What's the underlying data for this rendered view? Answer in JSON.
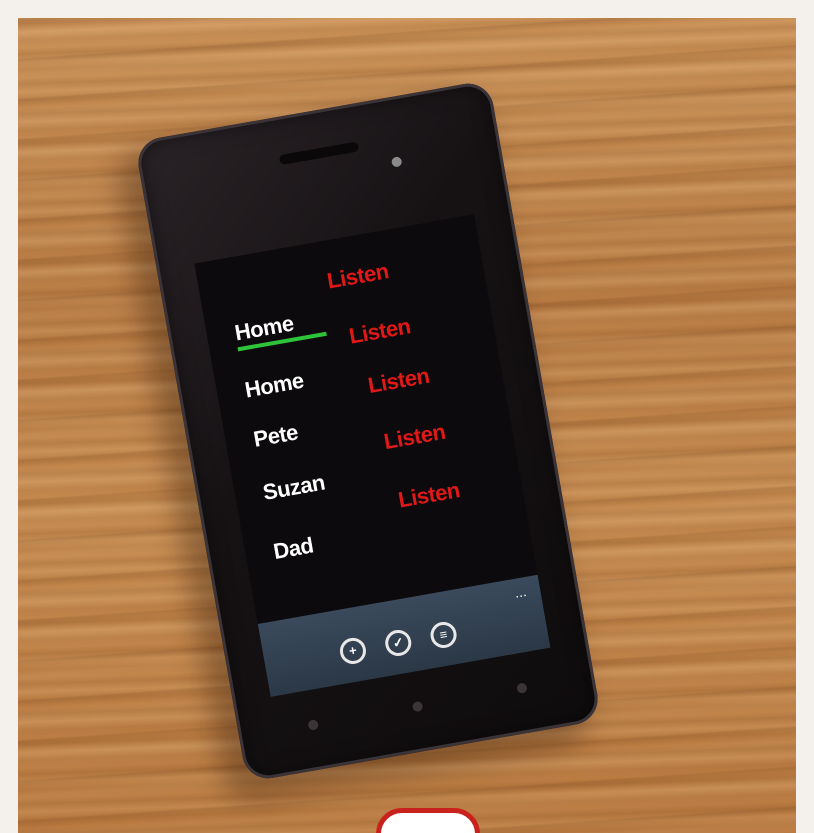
{
  "contacts": [
    {
      "name": "Home",
      "detail": "",
      "detail_color": "green"
    },
    {
      "name": "Home",
      "detail": "",
      "detail_color": "grey"
    },
    {
      "name": "Pete",
      "detail": "",
      "detail_color": "grey"
    },
    {
      "name": "Suzan",
      "detail": "",
      "detail_color": "grey"
    },
    {
      "name": "Dad",
      "detail": "",
      "detail_color": "grey"
    }
  ],
  "listen_label": "Listen",
  "app_bar": {
    "more": "...",
    "buttons": [
      {
        "icon": "add-icon",
        "glyph": "+"
      },
      {
        "icon": "check-icon",
        "glyph": "✓"
      },
      {
        "icon": "list-icon",
        "glyph": "≡"
      }
    ]
  },
  "colors": {
    "listen": "#e01818",
    "highlight": "#2ec43a",
    "badge_border": "#c9221c",
    "badge_icon": "#2a66c0"
  }
}
